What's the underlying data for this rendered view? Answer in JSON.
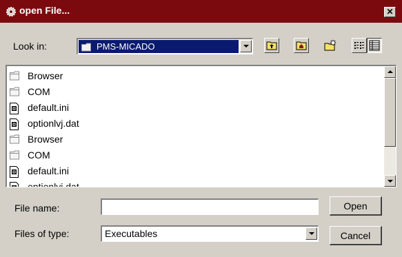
{
  "window": {
    "title": "open File...",
    "close_glyph": "✕"
  },
  "look_in": {
    "label": "Look in:",
    "selected": "PMS-MICADO"
  },
  "toolbar": {
    "icons": [
      "up-one-level-icon",
      "home-folder-icon",
      "new-folder-icon",
      "list-view-icon",
      "details-view-icon"
    ]
  },
  "files": [
    {
      "name": "Browser",
      "type": "folder"
    },
    {
      "name": "COM",
      "type": "folder"
    },
    {
      "name": "default.ini",
      "type": "file"
    },
    {
      "name": "optionlvj.dat",
      "type": "file"
    },
    {
      "name": "Browser",
      "type": "folder"
    },
    {
      "name": "COM",
      "type": "folder"
    },
    {
      "name": "default.ini",
      "type": "file"
    },
    {
      "name": "optionlvj.dat",
      "type": "file"
    }
  ],
  "file_name": {
    "label": "File name:",
    "value": ""
  },
  "file_type": {
    "label": "Files of type:",
    "selected": "Executables"
  },
  "buttons": {
    "open": "Open",
    "cancel": "Cancel"
  }
}
